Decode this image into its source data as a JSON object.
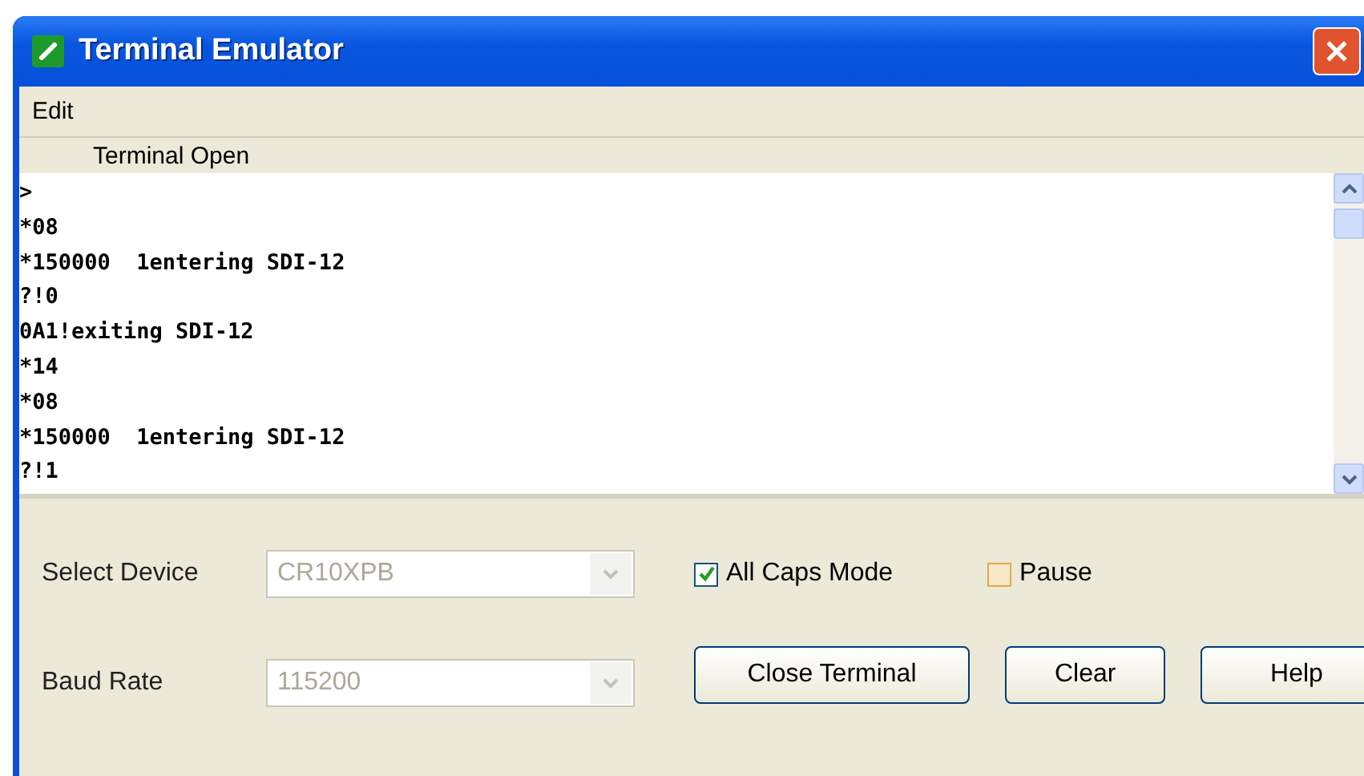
{
  "window": {
    "title": "Terminal Emulator"
  },
  "menu": [
    "Edit"
  ],
  "status": "Terminal Open",
  "terminal_lines": [
    ">",
    "*08",
    "*150000  1entering SDI-12",
    "?!0",
    "0A1!exiting SDI-12",
    "*14",
    "*08",
    "*150000  1entering SDI-12",
    "?!1"
  ],
  "fields": [
    {
      "label": "Select Device",
      "value": "CR10XPB",
      "disabled": true
    },
    {
      "label": "Baud Rate",
      "value": "115200",
      "disabled": true
    }
  ],
  "checkboxes": [
    {
      "label": "All Caps Mode",
      "checked": true
    },
    {
      "label": "Pause",
      "checked": false
    }
  ],
  "buttons": [
    "Close Terminal",
    "Clear",
    "Help"
  ]
}
